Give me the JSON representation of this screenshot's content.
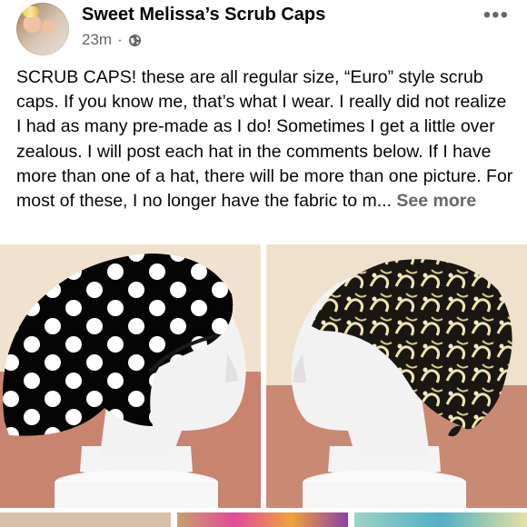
{
  "post": {
    "page_name": "Sweet Melissa’s Scrub Caps",
    "time": "23m",
    "separator": "·",
    "audience_icon": "globe-icon",
    "more_icon": "more-options-icon",
    "text": "SCRUB CAPS! these are all regular size, “Euro” style scrub caps. If you know me, that’s what I wear. I really did not realize I had as many pre-made as I do! Sometimes I get a little over zealous. I will post each hat in the comments below. If I have more than one of a hat, there will be more than one picture. For most of these, I no longer have the fabric to m...",
    "see_more": "See more"
  },
  "colors": {
    "text_primary": "#050505",
    "text_secondary": "#65676b",
    "background": "#ffffff"
  },
  "photos": [
    {
      "name": "polka-dot-scrub-cap-photo",
      "description_icon": "photo"
    },
    {
      "name": "black-cream-floral-scrub-cap-photo",
      "description_icon": "photo"
    }
  ]
}
